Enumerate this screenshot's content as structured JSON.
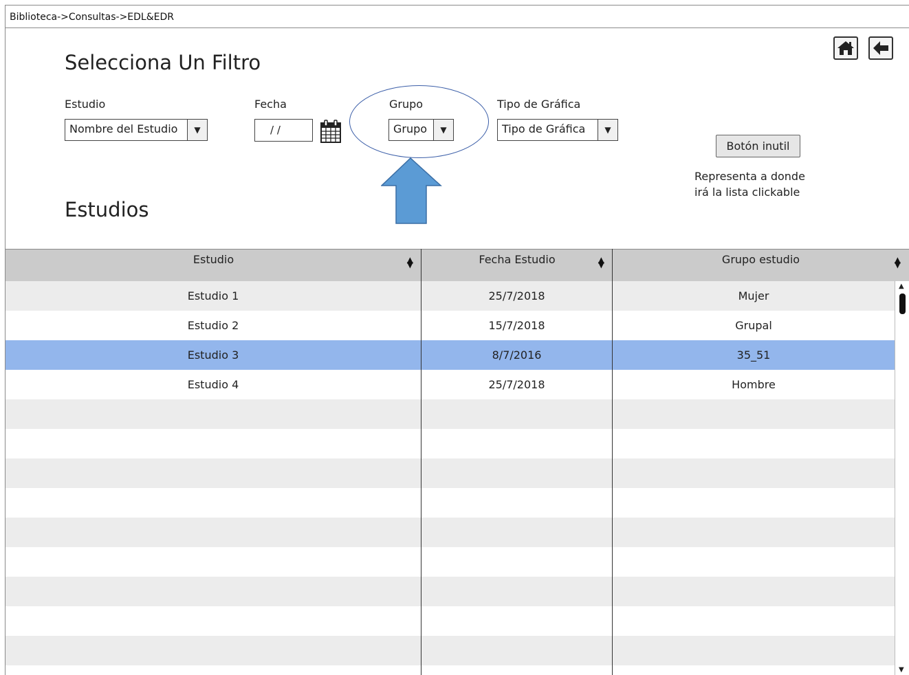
{
  "breadcrumb": "Biblioteca->Consultas->EDL&EDR",
  "page_title": "Selecciona Un Filtro",
  "section_title": "Estudios",
  "nav": {
    "home_icon": "home-icon",
    "back_icon": "arrow-left-icon"
  },
  "filters": {
    "estudio": {
      "label": "Estudio",
      "value": "Nombre del Estudio"
    },
    "fecha": {
      "label": "Fecha",
      "value": "/ /"
    },
    "grupo": {
      "label": "Grupo",
      "value": "Grupo"
    },
    "tipo_grafica": {
      "label": "Tipo de Gráfica",
      "value": "Tipo de Gráfica"
    }
  },
  "useless_button": "Botón inutil",
  "note": {
    "line1": "Representa a donde",
    "line2": "irá la lista clickable"
  },
  "table": {
    "headers": [
      "Estudio",
      "Fecha Estudio",
      "Grupo estudio"
    ],
    "rows": [
      [
        "Estudio 1",
        "25/7/2018",
        "Mujer"
      ],
      [
        "Estudio 2",
        "15/7/2018",
        "Grupal"
      ],
      [
        "Estudio 3",
        "8/7/2016",
        "35_51"
      ],
      [
        "Estudio 4",
        "25/7/2018",
        "Hombre"
      ]
    ],
    "selected_row_index": 2
  },
  "colors": {
    "selected_row": "#93b6ec",
    "header_bg": "#cbcbcb",
    "stripe": "#ececec",
    "annotation_arrow": "#5b9bd5",
    "annotation_ellipse": "#3b5ea8"
  }
}
